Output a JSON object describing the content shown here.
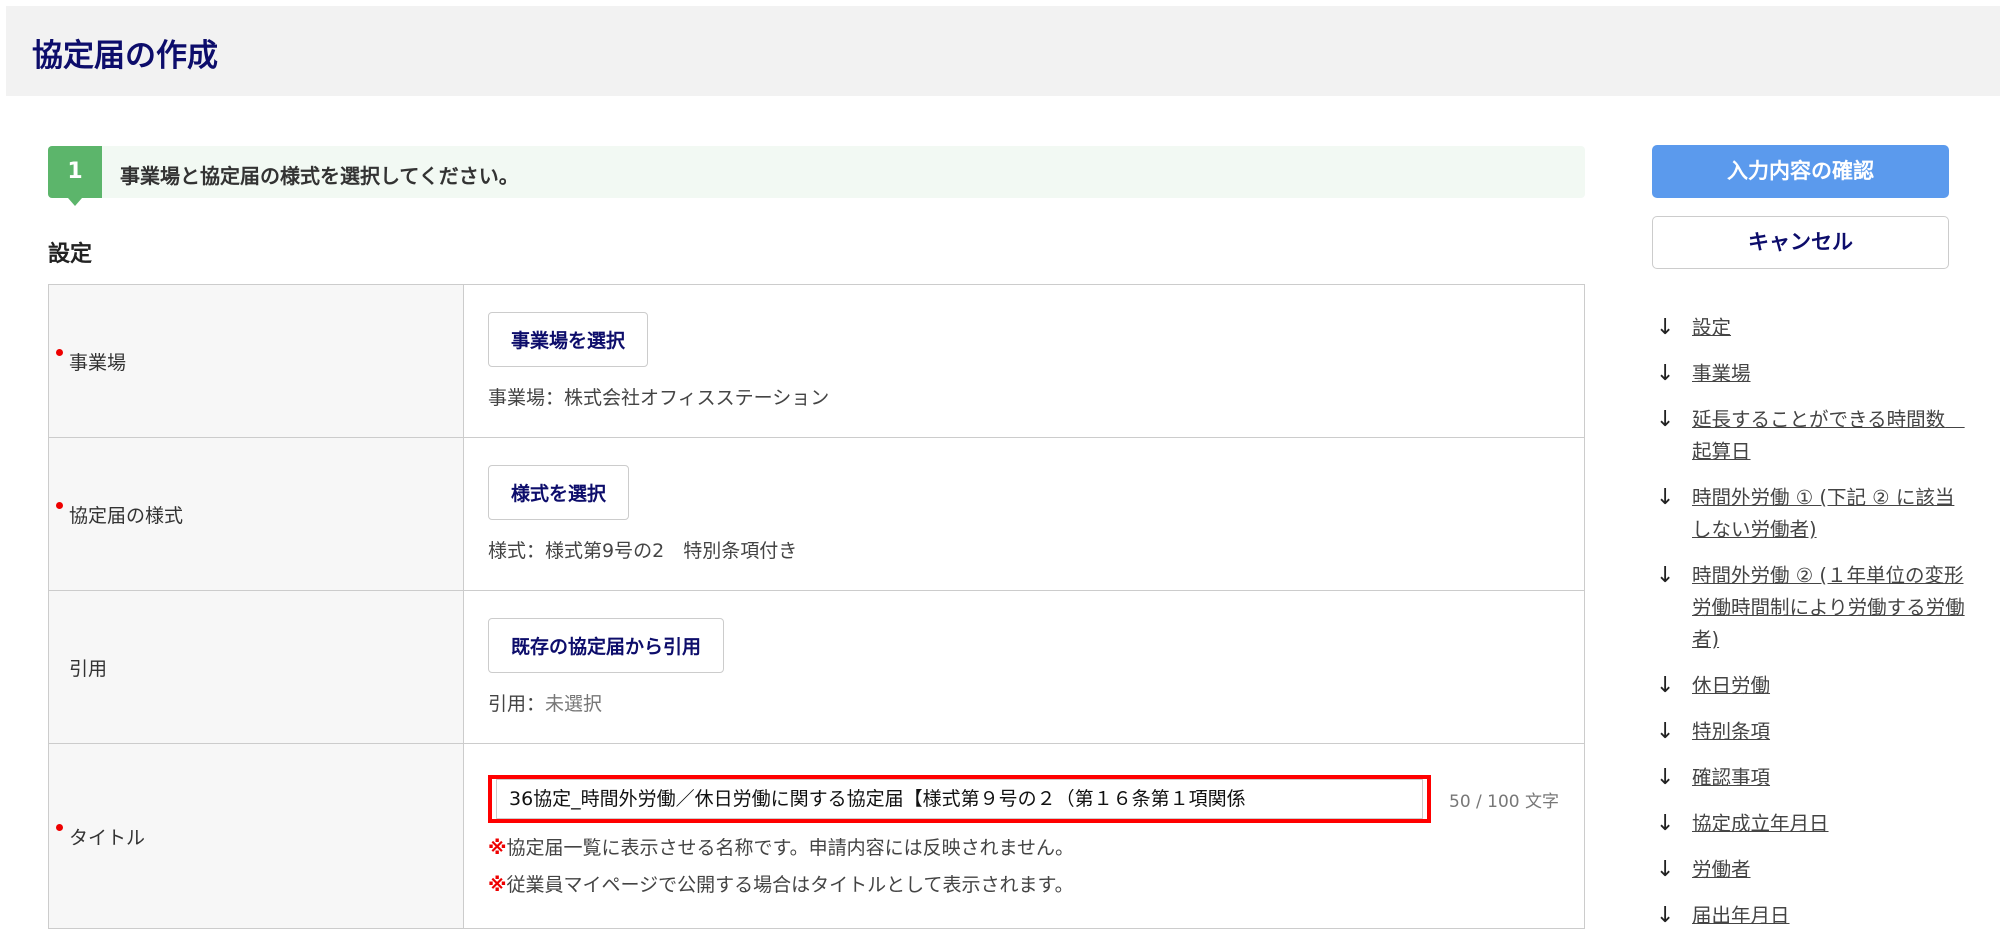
{
  "header": {
    "title": "協定届の作成"
  },
  "step": {
    "number": "1",
    "text": "事業場と協定届の様式を選択してください。"
  },
  "section_title": "設定",
  "rows": [
    {
      "label": "事業場",
      "required": true,
      "button": "事業場を選択",
      "info_label": "事業場：",
      "info_value": "株式会社オフィスステーション"
    },
    {
      "label": "協定届の様式",
      "required": true,
      "button": "様式を選択",
      "info_label": "様式：",
      "info_value": "様式第9号の2　特別条項付き"
    },
    {
      "label": "引用",
      "required": false,
      "button": "既存の協定届から引用",
      "info_label": "引用：",
      "info_value": "未選択"
    }
  ],
  "title_row": {
    "label": "タイトル",
    "value": "36協定_時間外労働／休日労働に関する協定届【様式第９号の２（第１６条第１項関係",
    "count": "50 / 100 文字",
    "note_mark": "※",
    "notes": [
      "協定届一覧に表示させる名称です。申請内容には反映されません。",
      "従業員マイページで公開する場合はタイトルとして表示されます。"
    ]
  },
  "actions": {
    "confirm": "入力内容の確認",
    "cancel": "キャンセル"
  },
  "nav": [
    "設定",
    "事業場",
    "延長することができる時間数　起算日",
    "時間外労働 ① (下記 ② に該当しない労働者)",
    "時間外労働 ② (１年単位の変形労働時間制により労働する労働者)",
    "休日労働",
    "特別条項",
    "確認事項",
    "協定成立年月日",
    "労働者",
    "届出年月日"
  ],
  "nav_arrow": "↓"
}
